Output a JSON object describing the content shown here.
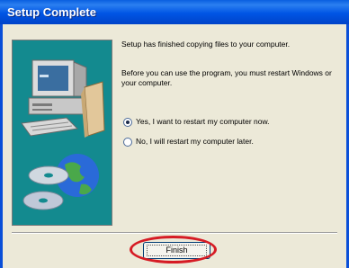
{
  "window": {
    "title": "Setup Complete"
  },
  "message": {
    "line1": "Setup has finished copying files to your computer.",
    "line2": "Before you can use the program, you must restart Windows or your computer."
  },
  "options": [
    {
      "label": "Yes, I want to restart my computer now.",
      "selected": true
    },
    {
      "label": "No, I will restart my computer later.",
      "selected": false
    }
  ],
  "buttons": {
    "finish": "Finish"
  },
  "colors": {
    "titlebar": "#0055e5",
    "side_panel": "#138a8f",
    "highlight": "#d61b24"
  },
  "icons": {
    "side_art": "computer-with-globe-and-discs"
  }
}
